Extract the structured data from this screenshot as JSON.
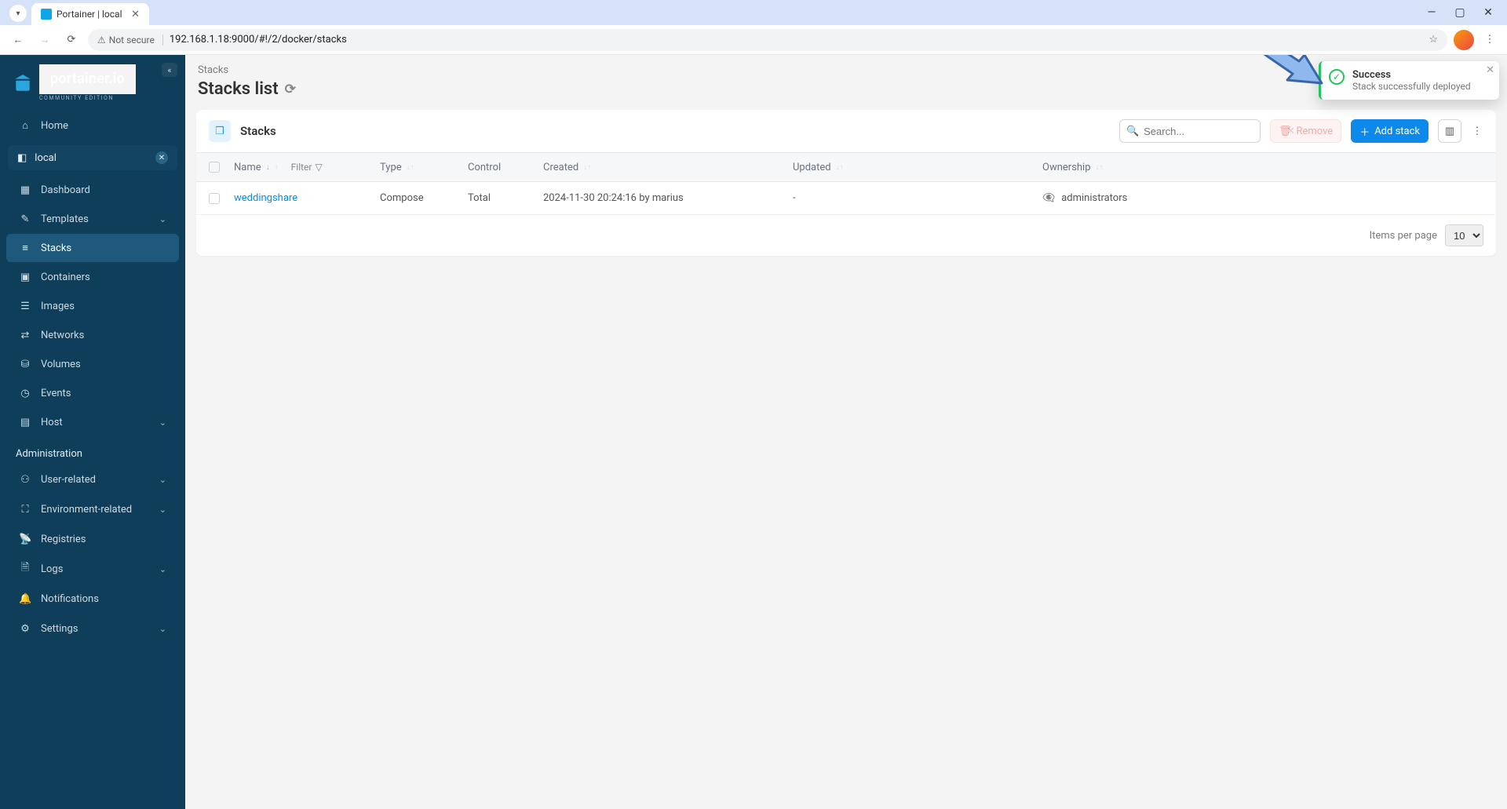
{
  "browser": {
    "tab_title": "Portainer | local",
    "security_label": "Not secure",
    "url": "192.168.1.18:9000/#!/2/docker/stacks"
  },
  "brand": {
    "name": "portainer.io",
    "edition": "Community Edition"
  },
  "sidebar": {
    "home": "Home",
    "env_label": "local",
    "items": [
      {
        "label": "Dashboard"
      },
      {
        "label": "Templates",
        "chev": true
      },
      {
        "label": "Stacks",
        "active": true
      },
      {
        "label": "Containers"
      },
      {
        "label": "Images"
      },
      {
        "label": "Networks"
      },
      {
        "label": "Volumes"
      },
      {
        "label": "Events"
      },
      {
        "label": "Host",
        "chev": true
      }
    ],
    "admin_title": "Administration",
    "admin_items": [
      {
        "label": "User-related",
        "chev": true
      },
      {
        "label": "Environment-related",
        "chev": true
      },
      {
        "label": "Registries"
      },
      {
        "label": "Logs",
        "chev": true
      },
      {
        "label": "Notifications"
      },
      {
        "label": "Settings",
        "chev": true
      }
    ]
  },
  "page": {
    "breadcrumb": "Stacks",
    "title": "Stacks list",
    "panel_title": "Stacks",
    "search_placeholder": "Search...",
    "remove_label": "Remove",
    "add_label": "Add stack",
    "columns": {
      "name": "Name",
      "filter": "Filter",
      "type": "Type",
      "control": "Control",
      "created": "Created",
      "updated": "Updated",
      "ownership": "Ownership"
    },
    "rows": [
      {
        "name": "weddingshare",
        "type": "Compose",
        "control": "Total",
        "created": "2024-11-30 20:24:16 by marius",
        "updated": "-",
        "ownership": "administrators"
      }
    ],
    "items_per_page_label": "Items per page",
    "items_per_page_value": "10"
  },
  "toast": {
    "title": "Success",
    "subtitle": "Stack successfully deployed"
  }
}
